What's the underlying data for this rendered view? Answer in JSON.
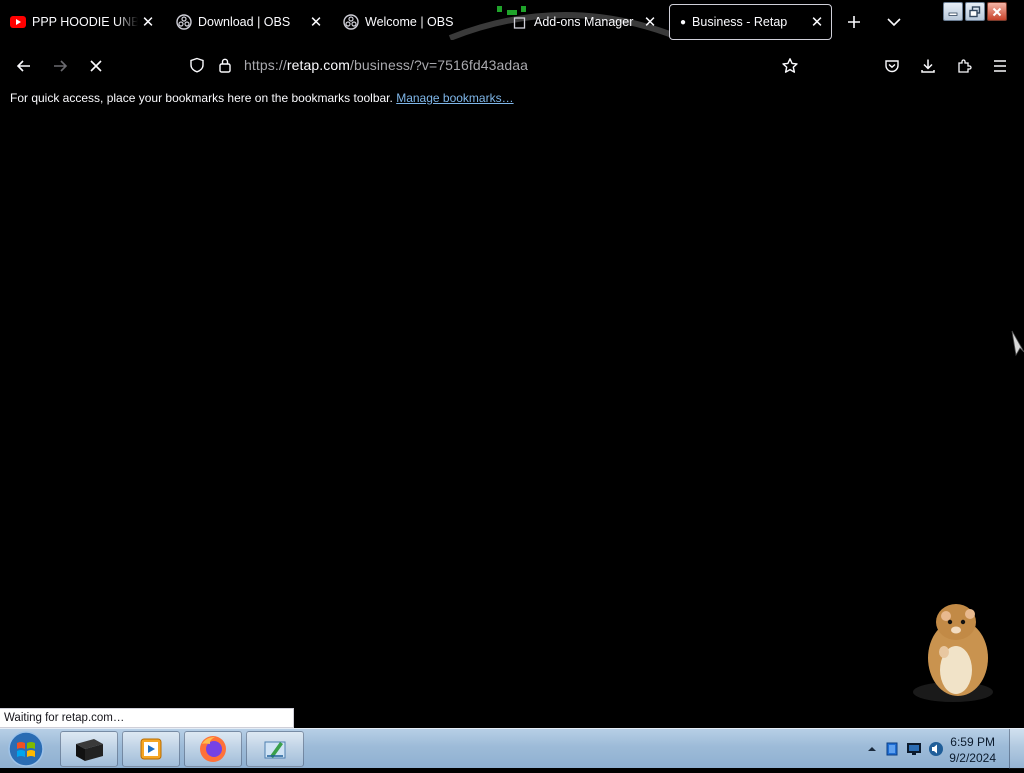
{
  "tabs": [
    {
      "title": "PPP HOODIE UNBOX",
      "icon": "youtube-icon"
    },
    {
      "title": "Download | OBS",
      "icon": "obs-icon"
    },
    {
      "title": "Welcome | OBS",
      "icon": "obs-icon"
    },
    {
      "title": "Add-ons Manager",
      "icon": "puzzle-icon"
    },
    {
      "title": "Business - Retap",
      "icon": "loading-dot",
      "active": true
    }
  ],
  "tab_close_glyph": "✕",
  "address": {
    "scheme": "https://",
    "host": "retap.com",
    "path": "/business/?v=7516fd43adaa"
  },
  "bookmarks_bar": {
    "message": "For quick access, place your bookmarks here on the bookmarks toolbar.",
    "link": "Manage bookmarks…"
  },
  "status": "Waiting for retap.com…",
  "taskbar": {
    "time": "6:59 PM",
    "date": "9/2/2024"
  },
  "colors": {
    "page_background": "#000000",
    "link": "#7fb6e8",
    "youtube_red": "#ff0000",
    "taskbar": "#9dbbd8"
  }
}
